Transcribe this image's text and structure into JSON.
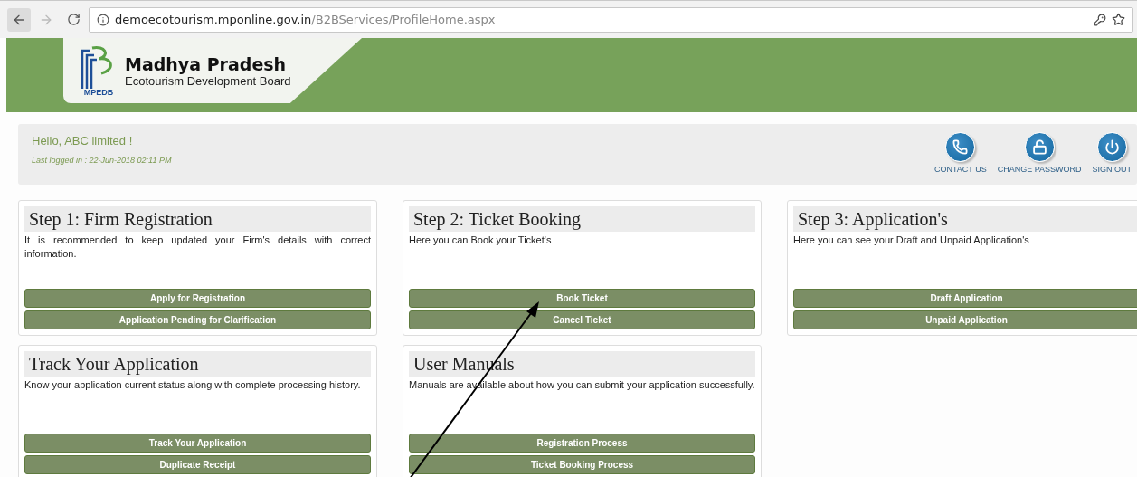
{
  "browser": {
    "url_host": "demoecotourism.mponline.gov.in",
    "url_path": "/B2BServices/ProfileHome.aspx"
  },
  "header": {
    "logo_abbr": "MPEDB",
    "title": "Madhya Pradesh",
    "subtitle": "Ecotourism Development Board"
  },
  "welcome": {
    "greeting": "Hello, ABC limited !",
    "last_login": "Last logged in : 22-Jun-2018 02:11 PM"
  },
  "actions": [
    {
      "kind": "phone",
      "label": "CONTACT US"
    },
    {
      "kind": "lock",
      "label": "CHANGE PASSWORD"
    },
    {
      "kind": "power",
      "label": "SIGN OUT"
    }
  ],
  "cards": [
    {
      "title": "Step 1: Firm Registration",
      "text": "It is recommended to keep updated your Firm's details with correct information.",
      "buttons": [
        "Apply for Registration",
        "Application Pending for Clarification"
      ]
    },
    {
      "title": "Step 2: Ticket Booking",
      "text": "Here you can Book your Ticket's",
      "buttons": [
        "Book Ticket",
        "Cancel Ticket"
      ]
    },
    {
      "title": "Step 3: Application's",
      "text": "Here you can see your Draft and Unpaid Application's",
      "buttons": [
        "Draft Application",
        "Unpaid Application"
      ]
    },
    {
      "title": "Track Your Application",
      "text": "Know your application current status along with complete processing history.",
      "buttons": [
        "Track Your Application",
        "Duplicate Receipt"
      ]
    },
    {
      "title": "User Manuals",
      "text": "Manuals are available about how you can submit your application successfully.",
      "buttons": [
        "Registration Process",
        "Ticket Booking Process"
      ]
    }
  ]
}
